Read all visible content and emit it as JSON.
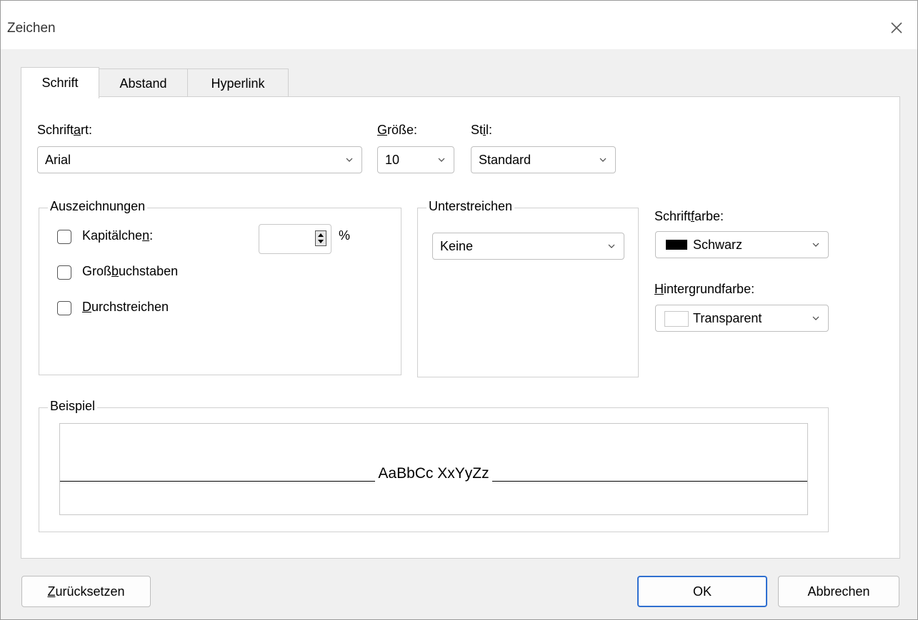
{
  "window": {
    "title": "Zeichen",
    "close_icon": "close-icon"
  },
  "tabs": [
    {
      "label": "Schrift",
      "active": true
    },
    {
      "label": "Abstand",
      "active": false
    },
    {
      "label": "Hyperlink",
      "active": false
    }
  ],
  "font": {
    "family_label_a": "Schrift",
    "family_label_u": "a",
    "family_label_b": "rt:",
    "family_value": "Arial",
    "size_label_u": "G",
    "size_label_b": "röße:",
    "size_value": "10",
    "style_label_a": "St",
    "style_label_u": "i",
    "style_label_b": "l:",
    "style_value": "Standard"
  },
  "effects": {
    "legend": "Auszeichnungen",
    "smallcaps_a": "Kapitälche",
    "smallcaps_u": "n",
    "smallcaps_b": ":",
    "smallcaps_percent_symbol": "%",
    "uppercase_a": "Groß",
    "uppercase_u": "b",
    "uppercase_b": "uchstaben",
    "strike_u": "D",
    "strike_b": "urchstreichen"
  },
  "underline": {
    "legend": "Unterstreichen",
    "value": "Keine"
  },
  "colors": {
    "font_label_a": "Schrift",
    "font_label_u": "f",
    "font_label_b": "arbe:",
    "font_value": "Schwarz",
    "font_swatch": "#000000",
    "bg_label_u": "H",
    "bg_label_b": "intergrundfarbe:",
    "bg_value": "Transparent",
    "bg_swatch": "#ffffff"
  },
  "preview": {
    "legend": "Beispiel",
    "sample": "AaBbCc XxYyZz"
  },
  "buttons": {
    "reset_u": "Z",
    "reset_b": "urücksetzen",
    "ok": "OK",
    "cancel": "Abbrechen"
  },
  "accent": "#2f6fd0"
}
